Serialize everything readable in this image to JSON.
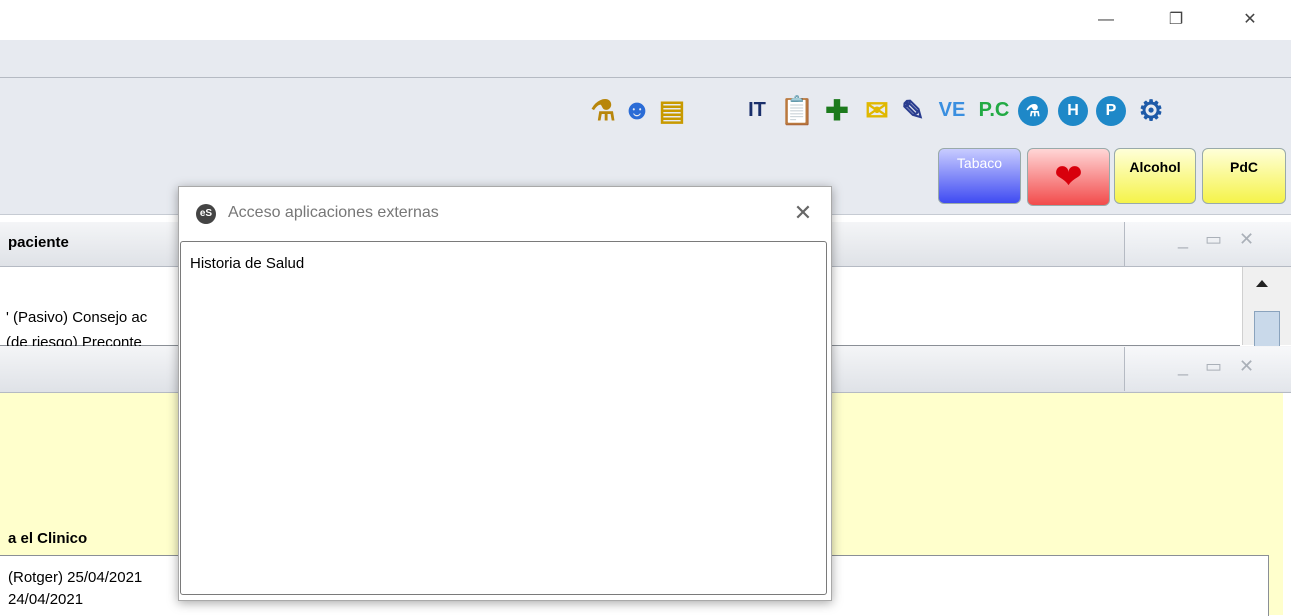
{
  "window": {
    "minimize_glyph": "—",
    "maximize_glyph": "❐",
    "close_glyph": "✕"
  },
  "toolbar": {
    "icons": [
      {
        "name": "lab-flask-icon",
        "glyph": "⚗",
        "color": "#b8860b"
      },
      {
        "name": "doctor-icon",
        "glyph": "☻",
        "color": "#2b6cd6"
      },
      {
        "name": "document-list-icon",
        "glyph": "▤",
        "color": "#c89a00"
      },
      {
        "name": "it-icon",
        "text": "IT",
        "color": "#1a2f6b"
      },
      {
        "name": "clipboard-icon",
        "glyph": "📋",
        "color": "#c89a00"
      },
      {
        "name": "add-prescription-icon",
        "glyph": "✚",
        "color": "#1c7a1c"
      },
      {
        "name": "email-icon",
        "glyph": "✉",
        "color": "#e0b800"
      },
      {
        "name": "syringe-icon",
        "glyph": "✎",
        "color": "#2a3d8f"
      },
      {
        "name": "ve-icon",
        "text": "VE",
        "color": "#3a8fe0"
      },
      {
        "name": "pc-icon",
        "text": "P.C",
        "color": "#22aa44"
      },
      {
        "name": "lab-circle-icon",
        "glyph": "⚗",
        "color": "#1e88c8"
      },
      {
        "name": "h-circle-icon",
        "text": "H",
        "color": "#1e88c8"
      },
      {
        "name": "p-circle-icon",
        "text": "P",
        "color": "#1e88c8"
      },
      {
        "name": "settings-gear-icon",
        "glyph": "⚙",
        "color": "#1e5aa8"
      }
    ],
    "buttons": {
      "tabaco": "Tabaco",
      "heart": "❤",
      "alcohol": "Alcohol",
      "pdc": "PdC"
    }
  },
  "panel_top": {
    "title": "paciente",
    "line1": "' (Pasivo) Consejo ac",
    "line2": " (de riesgo) Preconte"
  },
  "panel_bottom": {
    "section_label": "a el Clinico",
    "line1": "(Rotger) 25/04/2021",
    "line2": "24/04/2021"
  },
  "dialog": {
    "app_badge": "eS",
    "title": "Acceso aplicaciones externas",
    "close": "✕",
    "items": [
      "Historia de Salud"
    ]
  },
  "panel_controls": "_ ▭ ✕"
}
